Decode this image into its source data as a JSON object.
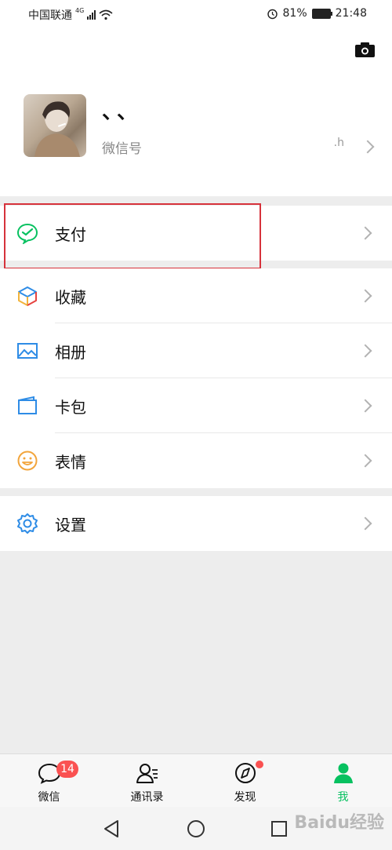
{
  "status_bar": {
    "carrier": "中国联通",
    "network": "4G",
    "battery": "81%",
    "time": "21:48"
  },
  "profile": {
    "nickname": "、、",
    "wechat_id_label": "微信号",
    "wechat_id_value_visible": ".h"
  },
  "menu": {
    "pay": "支付",
    "favorites": "收藏",
    "album": "相册",
    "cards": "卡包",
    "stickers": "表情",
    "settings": "设置"
  },
  "tabbar": {
    "chats": "微信",
    "chats_badge": "14",
    "contacts": "通讯录",
    "discover": "发现",
    "me": "我"
  },
  "colors": {
    "accent": "#07c160",
    "badge": "#fa5151",
    "highlight_box": "#d6323b"
  },
  "watermark": "Baidu经验"
}
